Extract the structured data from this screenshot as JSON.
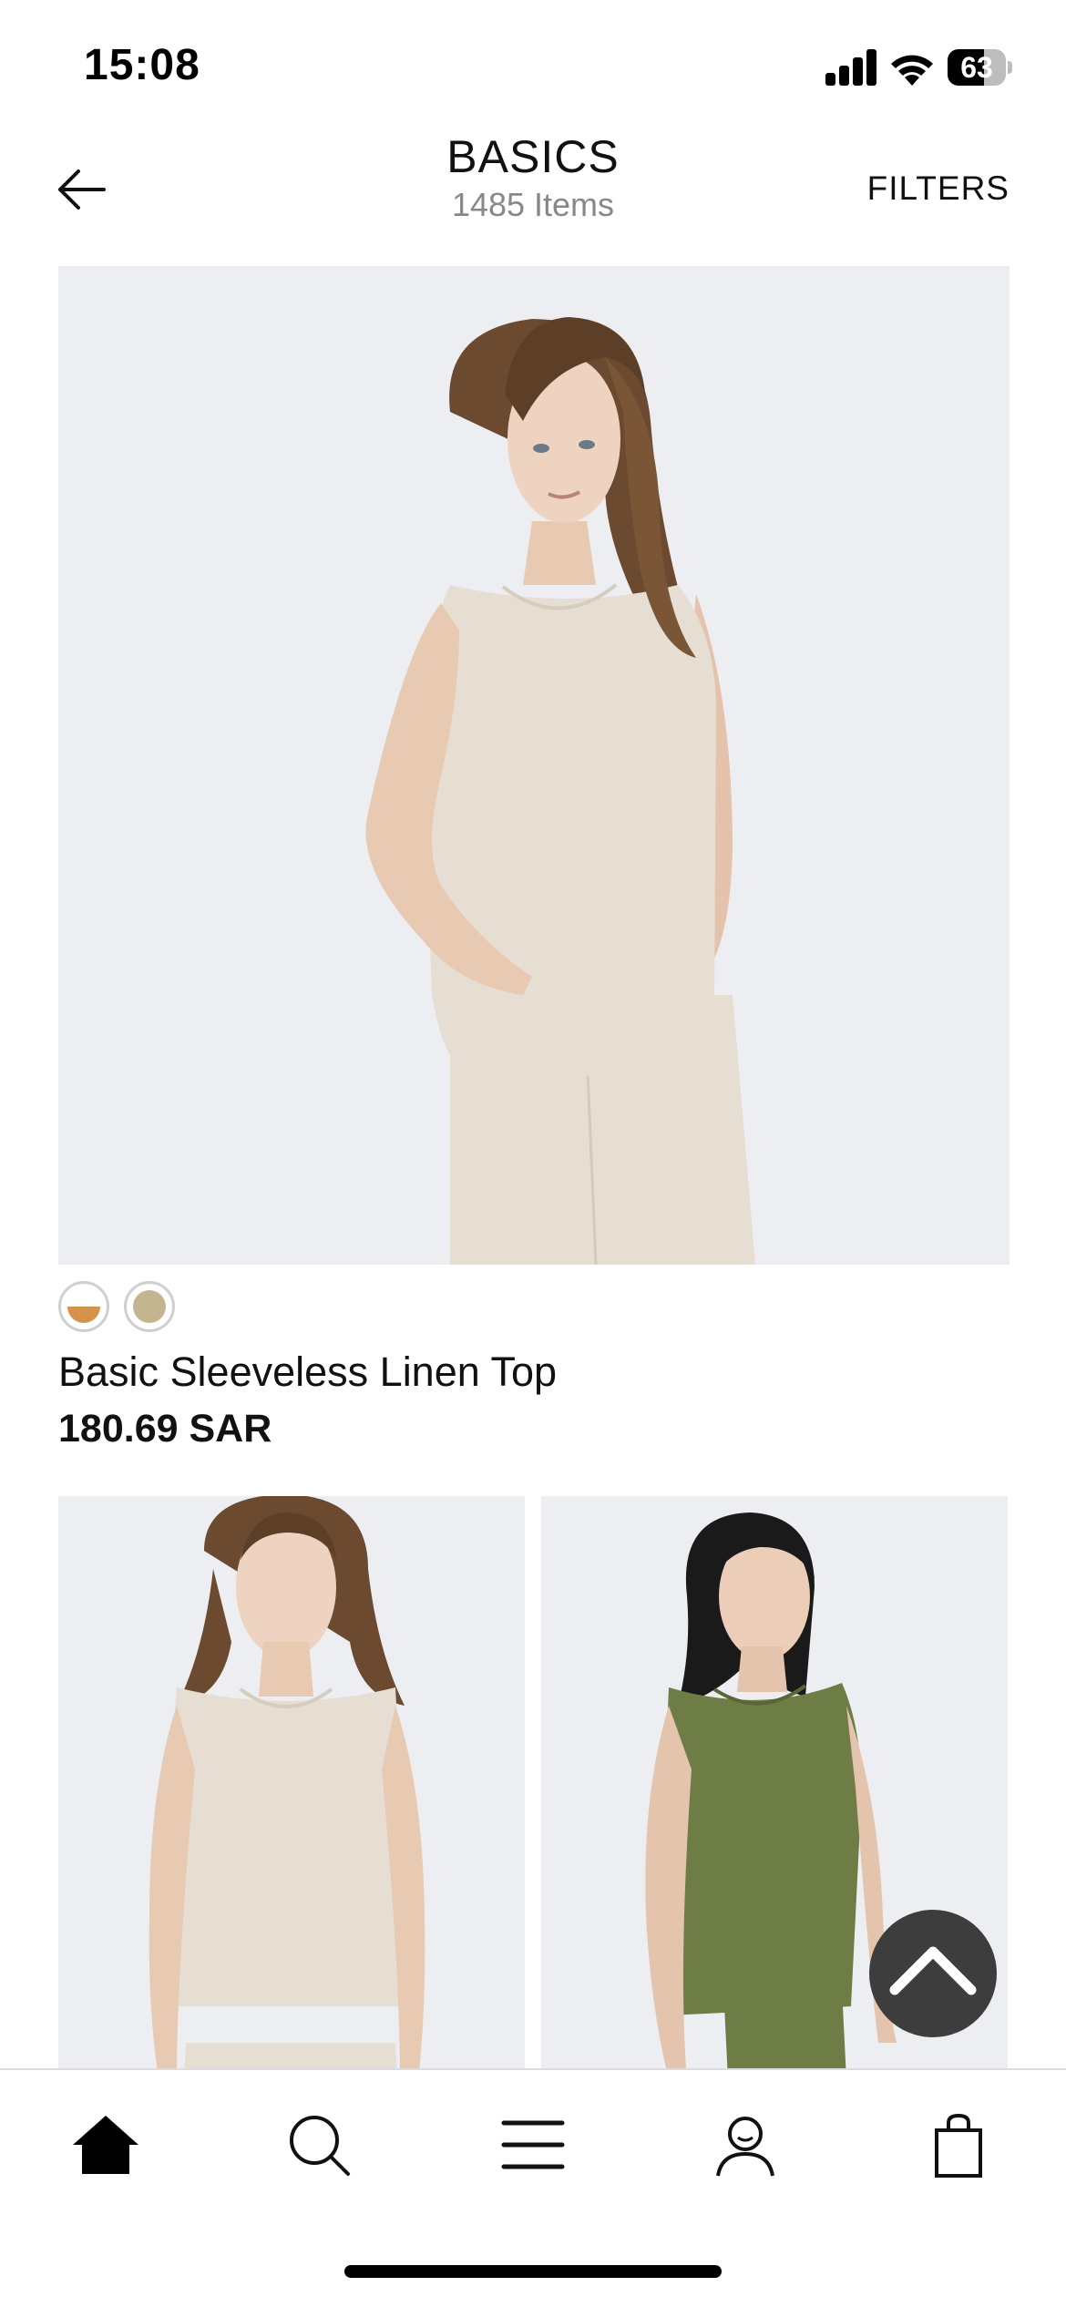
{
  "status_bar": {
    "time": "15:08",
    "battery_percent": "63",
    "battery_level": 0.63
  },
  "header": {
    "title": "BASICS",
    "item_count": "1485 Items",
    "filters_label": "FILTERS",
    "back_icon": "arrow-left-icon"
  },
  "products": [
    {
      "name": "Basic Sleeveless Linen Top",
      "price": "180.69 SAR",
      "swatches": [
        {
          "color": "#d4924a",
          "secondary": "#ffffff",
          "selected": true
        },
        {
          "color": "#c2b590",
          "selected": false
        }
      ],
      "garment_color": "#e6ded2"
    },
    {
      "garment_color": "#e6ded2"
    },
    {
      "garment_color": "#6e7c45"
    }
  ],
  "scroll_top_icon": "chevron-up-icon",
  "tab_bar": {
    "items": [
      {
        "icon": "home-icon",
        "active": true
      },
      {
        "icon": "search-icon",
        "active": false
      },
      {
        "icon": "menu-icon",
        "active": false
      },
      {
        "icon": "profile-icon",
        "active": false
      },
      {
        "icon": "bag-icon",
        "active": false
      }
    ]
  },
  "colors": {
    "photo_background": "#eceef2",
    "secondary_text": "#888888",
    "accent": "#111111"
  }
}
